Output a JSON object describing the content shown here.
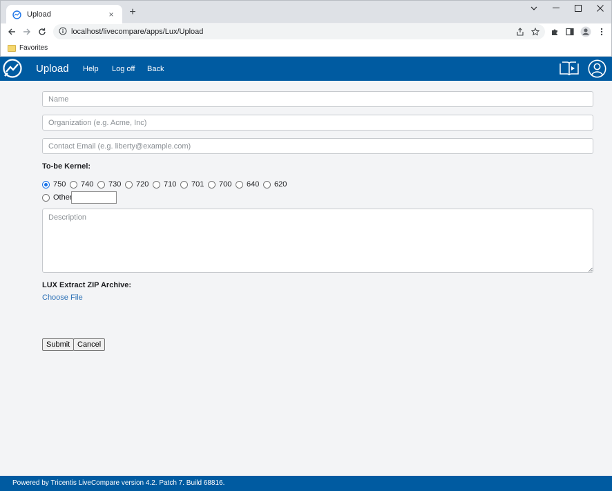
{
  "browser": {
    "tab_title": "Upload",
    "tab_close": "×",
    "new_tab": "+",
    "url": "localhost/livecompare/apps/Lux/Upload",
    "bookmark_folder": "Favorites"
  },
  "app": {
    "title": "Upload",
    "nav": [
      "Help",
      "Log off",
      "Back"
    ]
  },
  "form": {
    "name_placeholder": "Name",
    "organization_placeholder": "Organization (e.g. Acme, Inc)",
    "email_placeholder": "Contact Email (e.g. liberty@example.com)",
    "kernel_label": "To-be Kernel:",
    "kernel_options": [
      "750",
      "740",
      "730",
      "720",
      "710",
      "701",
      "700",
      "640",
      "620"
    ],
    "kernel_selected": "750",
    "other_label": "Other",
    "other_value": "",
    "description_placeholder": "Description",
    "archive_label": "LUX Extract ZIP Archive:",
    "choose_file": "Choose File",
    "submit": "Submit",
    "cancel": "Cancel"
  },
  "footer": "Powered by Tricentis LiveCompare version 4.2. Patch 7. Build 68816.",
  "colors": {
    "brand": "#005ba1",
    "link": "#2a6fb5",
    "page_bg": "#f3f4f6"
  }
}
